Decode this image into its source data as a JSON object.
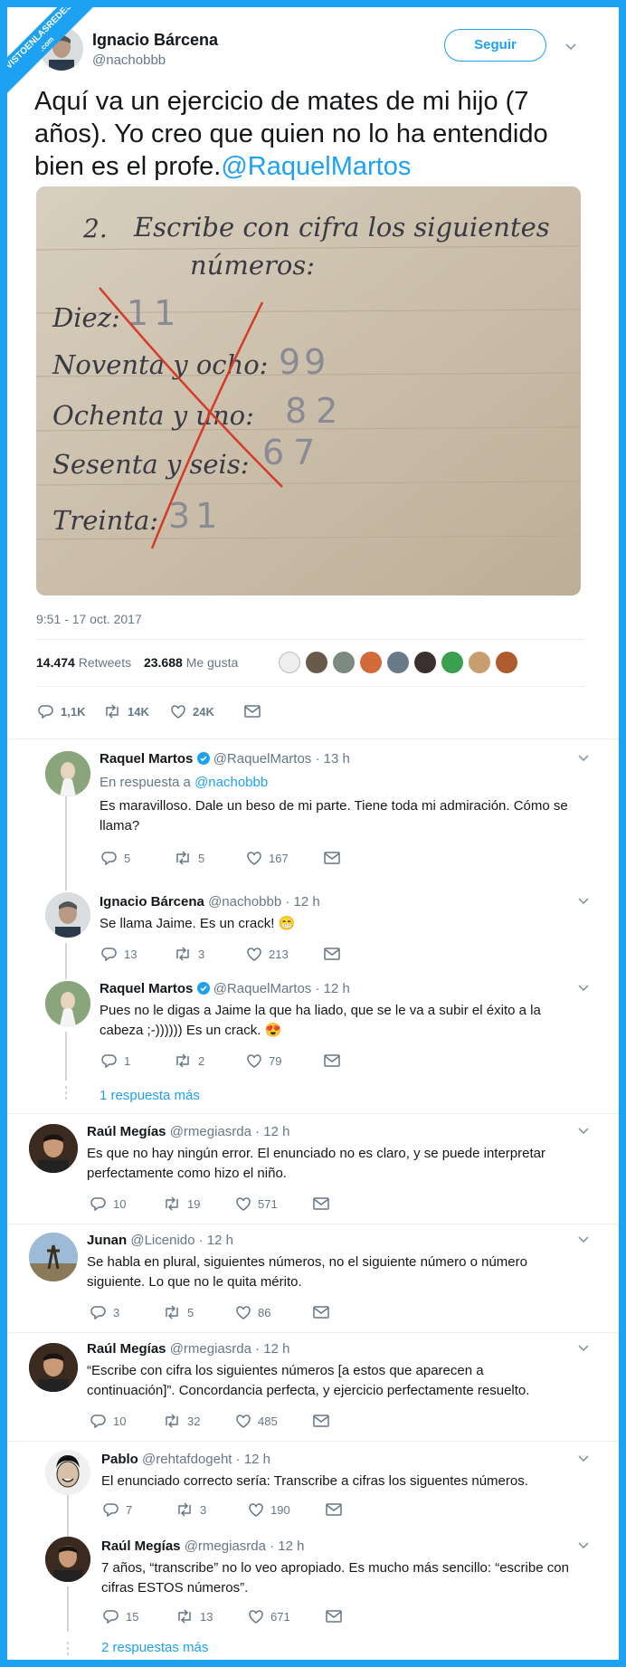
{
  "badge": {
    "line1": "VISTOENLASREDES",
    ".": "",
    "line2": ".com"
  },
  "tweet": {
    "name": "Ignacio Bárcena",
    "handle": "@nachobbb",
    "follow_label": "Seguir",
    "text_lines": [
      "Aquí va un ejercicio de mates de mi hijo (7",
      "años). Yo creo que quien no lo ha entendido",
      "bien es el profe."
    ],
    "mention": "@RaquelMartos",
    "photo": {
      "title_num": "2.",
      "title_1": "Escribe con cifra los siguientes",
      "title_2": "números:",
      "rows": [
        {
          "label": "Diez:",
          "answer": "11"
        },
        {
          "label": "Noventa y ocho:",
          "answer": "99"
        },
        {
          "label": "Ochenta y uno:",
          "answer": "82"
        },
        {
          "label": "Sesenta y seis:",
          "answer": "67"
        },
        {
          "label": "Treinta:",
          "answer": "31"
        }
      ]
    },
    "timestamp": "9:51 - 17 oct. 2017",
    "retweets_count": "14.474",
    "retweets_label": "Retweets",
    "likes_count": "23.688",
    "likes_label": "Me gusta",
    "actions": {
      "replies": "1,1K",
      "retweets": "14K",
      "likes": "24K"
    }
  },
  "replies": [
    {
      "name": "Raquel Martos",
      "verified": true,
      "handle": "@RaquelMartos",
      "time": "· 13 h",
      "in_reply_prefix": "En respuesta a",
      "in_reply_handle": "@nachobbb",
      "lines": [
        "Es maravilloso. Dale un beso de mi parte. Tiene toda mi admiración. Cómo se",
        "llama?"
      ],
      "counts": {
        "r": "5",
        "rt": "5",
        "l": "167"
      }
    },
    {
      "name": "Ignacio Bárcena",
      "handle": "@nachobbb",
      "time": "· 12 h",
      "lines": [
        "Se llama Jaime. Es un crack! 😁"
      ],
      "counts": {
        "r": "13",
        "rt": "3",
        "l": "213"
      }
    },
    {
      "name": "Raquel Martos",
      "verified": true,
      "handle": "@RaquelMartos",
      "time": "· 12 h",
      "lines": [
        "Pues no le digas a Jaime la que ha liado, que se le va a subir el éxito a la",
        "cabeza ;-)))))) Es un crack. 😍"
      ],
      "counts": {
        "r": "1",
        "rt": "2",
        "l": "79"
      }
    },
    {
      "name": "Raúl Megías",
      "handle": "@rmegiasrda",
      "time": "· 12 h",
      "lines": [
        "Es que no hay ningún error. El enunciado no es claro, y se puede interpretar",
        "perfectamente como hizo el niño."
      ],
      "counts": {
        "r": "10",
        "rt": "19",
        "l": "571"
      }
    },
    {
      "name": "Junan",
      "handle": "@Licenido",
      "time": "· 12 h",
      "lines": [
        "Se habla en plural, siguientes números, no el siguiente número o número",
        "siguiente. Lo que no le quita mérito."
      ],
      "counts": {
        "r": "3",
        "rt": "5",
        "l": "86"
      }
    },
    {
      "name": "Raúl Megías",
      "handle": "@rmegiasrda",
      "time": "· 12 h",
      "lines": [
        "“Escribe con cifra los siguientes números [a estos que aparecen a",
        "continuación]”. Concordancia perfecta, y ejercicio perfectamente resuelto."
      ],
      "counts": {
        "r": "10",
        "rt": "32",
        "l": "485"
      }
    },
    {
      "name": "Pablo",
      "handle": "@rehtafdogeht",
      "time": "· 12 h",
      "lines": [
        "El enunciado correcto sería: Transcribe a cifras los siguentes números."
      ],
      "counts": {
        "r": "7",
        "rt": "3",
        "l": "190"
      }
    },
    {
      "name": "Raúl Megías",
      "handle": "@rmegiasrda",
      "time": "· 12 h",
      "lines": [
        "7 años, “transcribe” no lo veo apropiado. Es mucho más sencillo: “escribe con",
        "cifras ESTOS números”."
      ],
      "counts": {
        "r": "15",
        "rt": "13",
        "l": "671"
      }
    }
  ],
  "more_1": "1 respuesta más",
  "more_2": "2 respuestas más",
  "colors": {
    "accent": "#1da1f2",
    "like_avatar_1": "#6a7a8a",
    "red_pen": "#d53a2a"
  }
}
